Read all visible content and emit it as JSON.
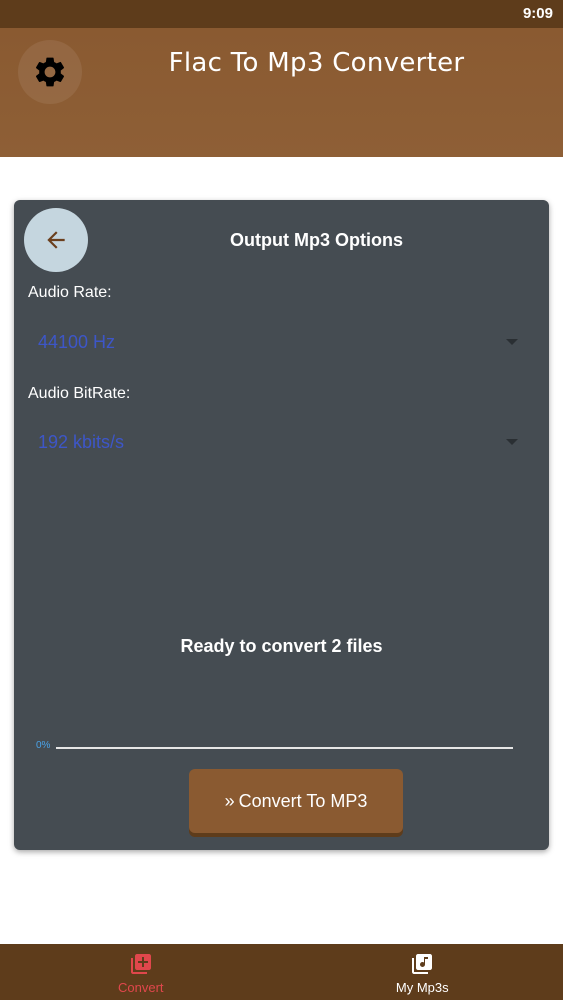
{
  "status_bar": {
    "time": "9:09"
  },
  "header": {
    "title": "Flac To Mp3 Converter",
    "settings_icon": "gear-icon"
  },
  "card": {
    "title": "Output Mp3 Options",
    "back_icon": "arrow-back-icon",
    "audio_rate": {
      "label": "Audio Rate:",
      "value": "44100 Hz"
    },
    "audio_bitrate": {
      "label": "Audio BitRate:",
      "value": "192 kbits/s"
    },
    "ready_text": "Ready to convert 2 files",
    "progress": {
      "label": "0%",
      "value": 0
    },
    "convert_button": {
      "label": "Convert To MP3",
      "icon": "double-chevron-right-icon"
    }
  },
  "bottom_nav": {
    "items": [
      {
        "label": "Convert",
        "icon": "add-library-icon",
        "active": true
      },
      {
        "label": "My Mp3s",
        "icon": "music-library-icon",
        "active": false
      }
    ]
  },
  "colors": {
    "header_bg": "#8a5a31",
    "status_bg": "#5e3c1b",
    "card_bg": "#454c52",
    "accent_active": "#e0474c",
    "dropdown_text": "#3d56c8"
  }
}
